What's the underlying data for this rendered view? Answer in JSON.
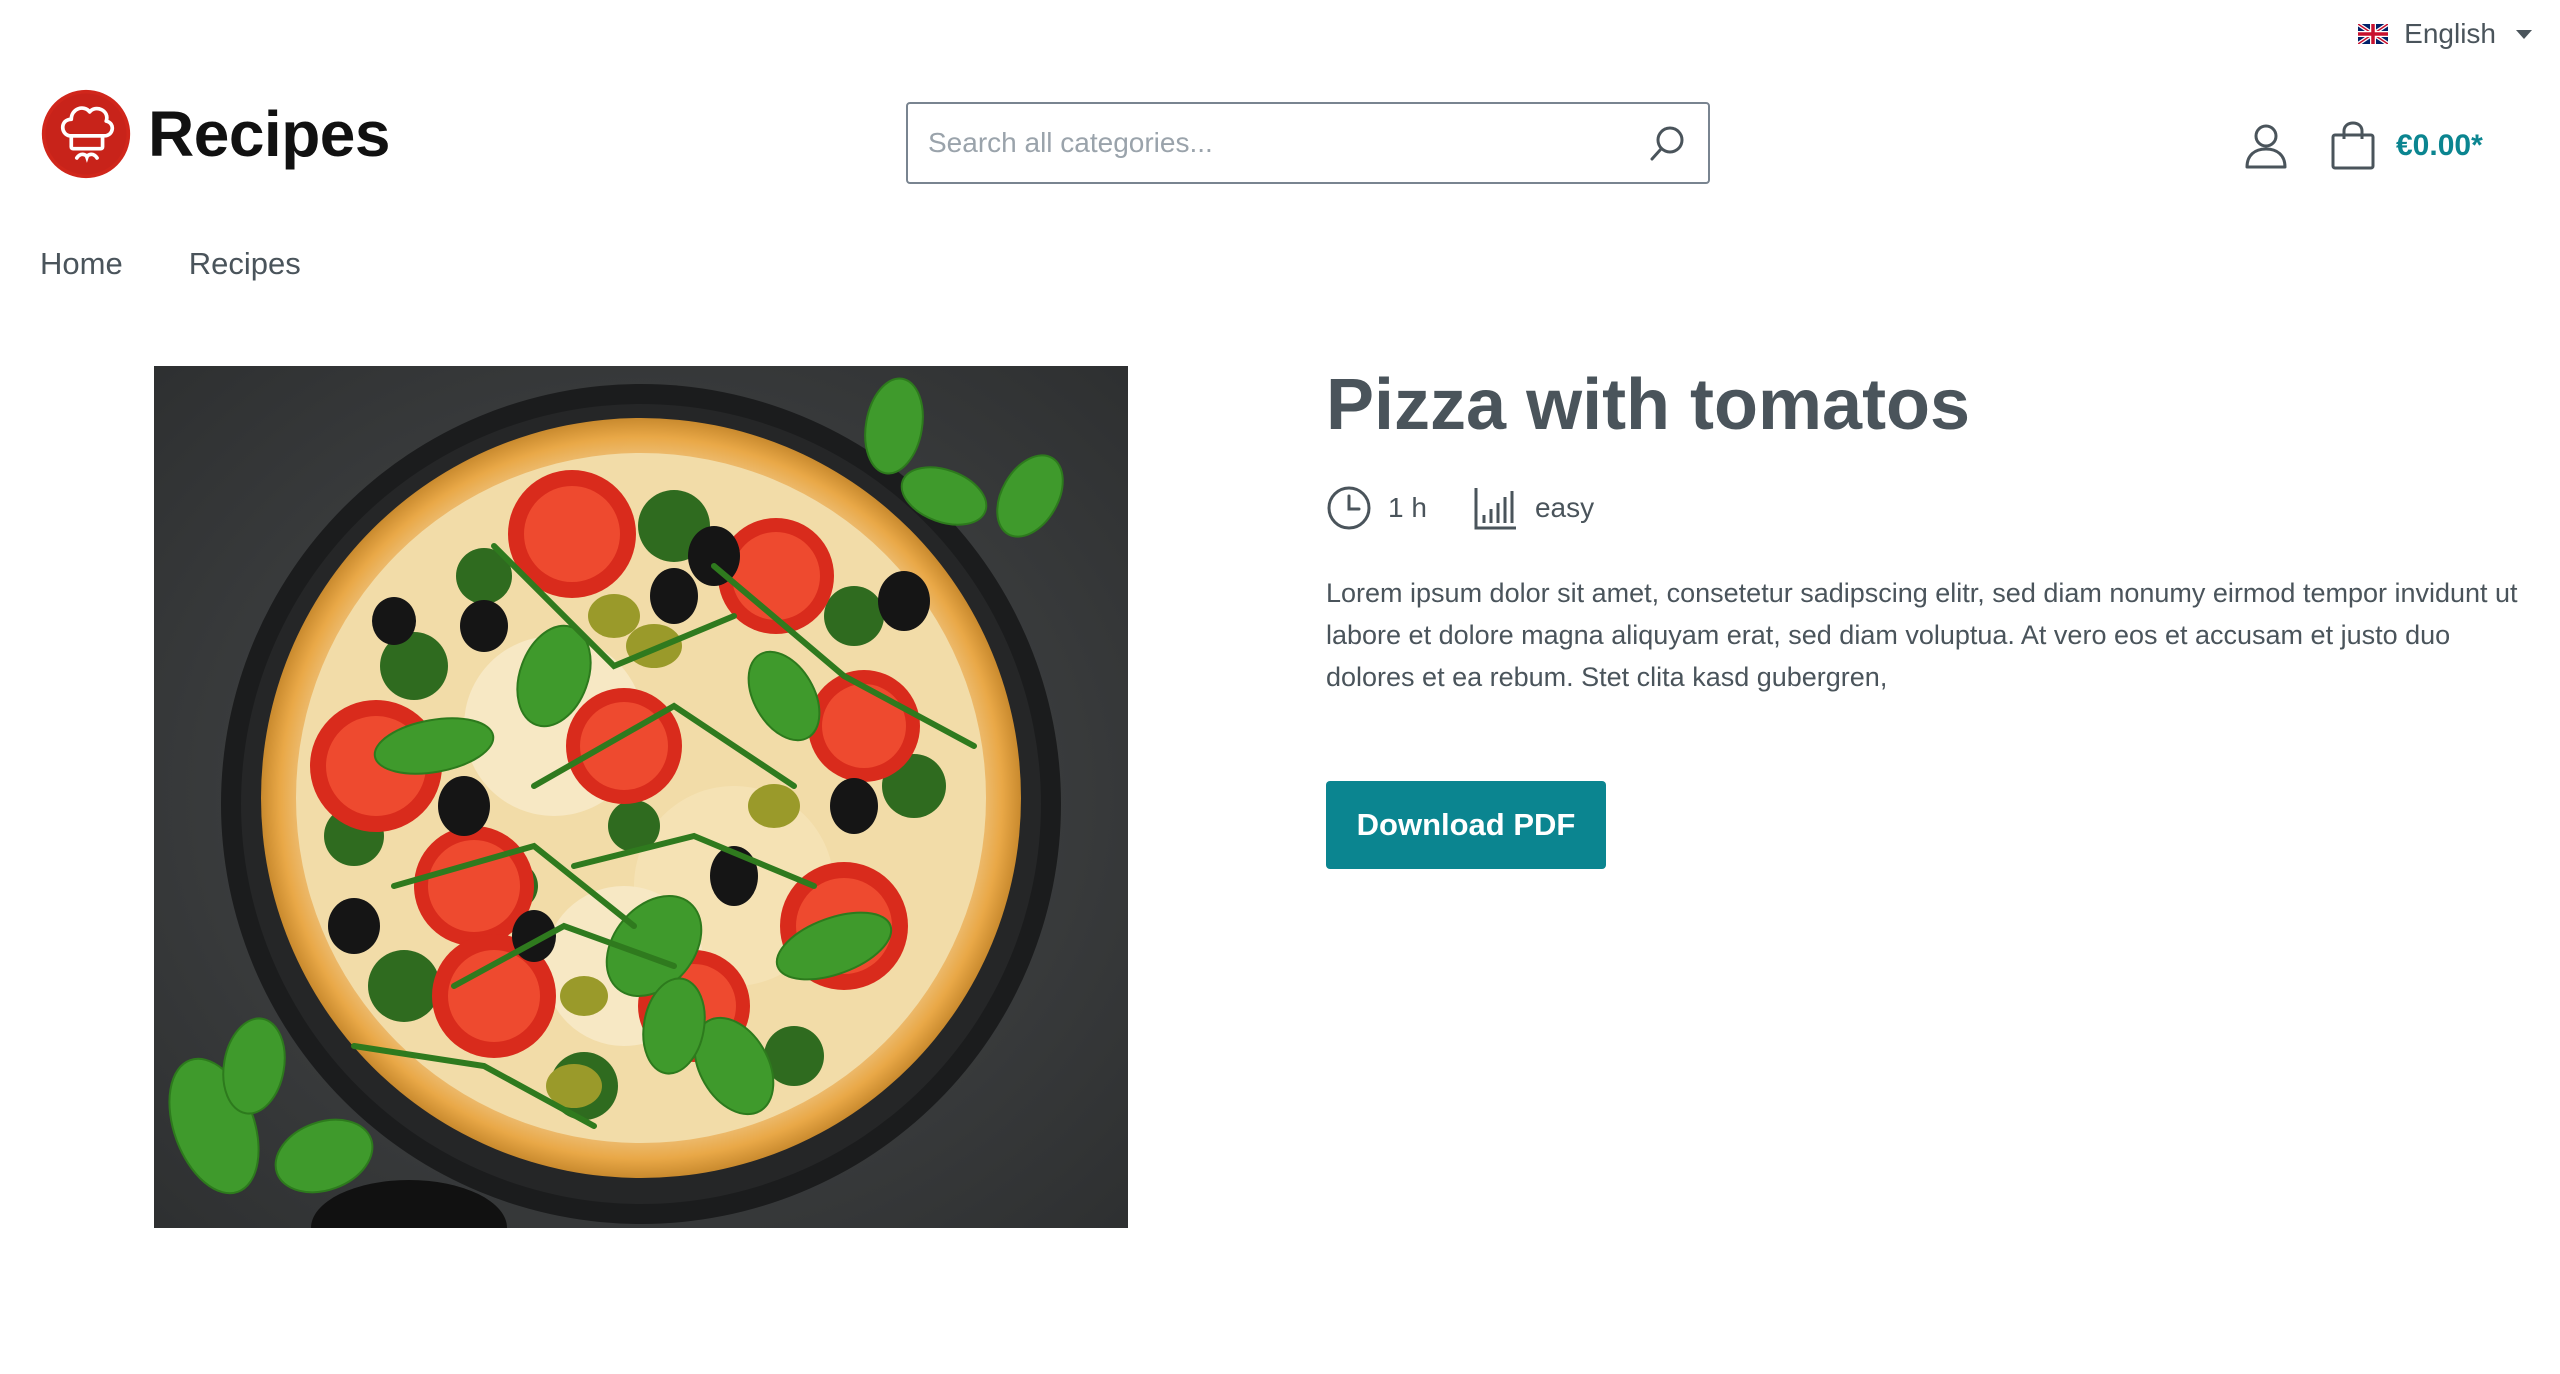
{
  "language": {
    "label": "English",
    "flag_icon": "uk-flag-icon"
  },
  "header": {
    "logo_text": "Recipes",
    "logo_icon": "chef-hat-logo",
    "search": {
      "placeholder": "Search all categories...",
      "value": ""
    },
    "account_icon": "user-icon",
    "cart_icon": "shopping-bag-icon",
    "cart_total": "€0.00*"
  },
  "nav": {
    "items": [
      {
        "label": "Home"
      },
      {
        "label": "Recipes"
      }
    ]
  },
  "product": {
    "image_subject": "pizza",
    "title": "Pizza with tomatos",
    "duration": "1 h",
    "difficulty": "easy",
    "description": "Lorem ipsum dolor sit amet, consetetur sadipscing elitr, sed diam nonumy eirmod tempor invidunt ut labore et dolore magna aliquyam erat, sed diam voluptua. At vero eos et accusam et justo duo dolores et ea rebum. Stet clita kasd gubergren,",
    "download_label": "Download PDF"
  },
  "colors": {
    "accent": "#0b8590",
    "text": "#4a545b",
    "logo_red": "#d0261b"
  }
}
